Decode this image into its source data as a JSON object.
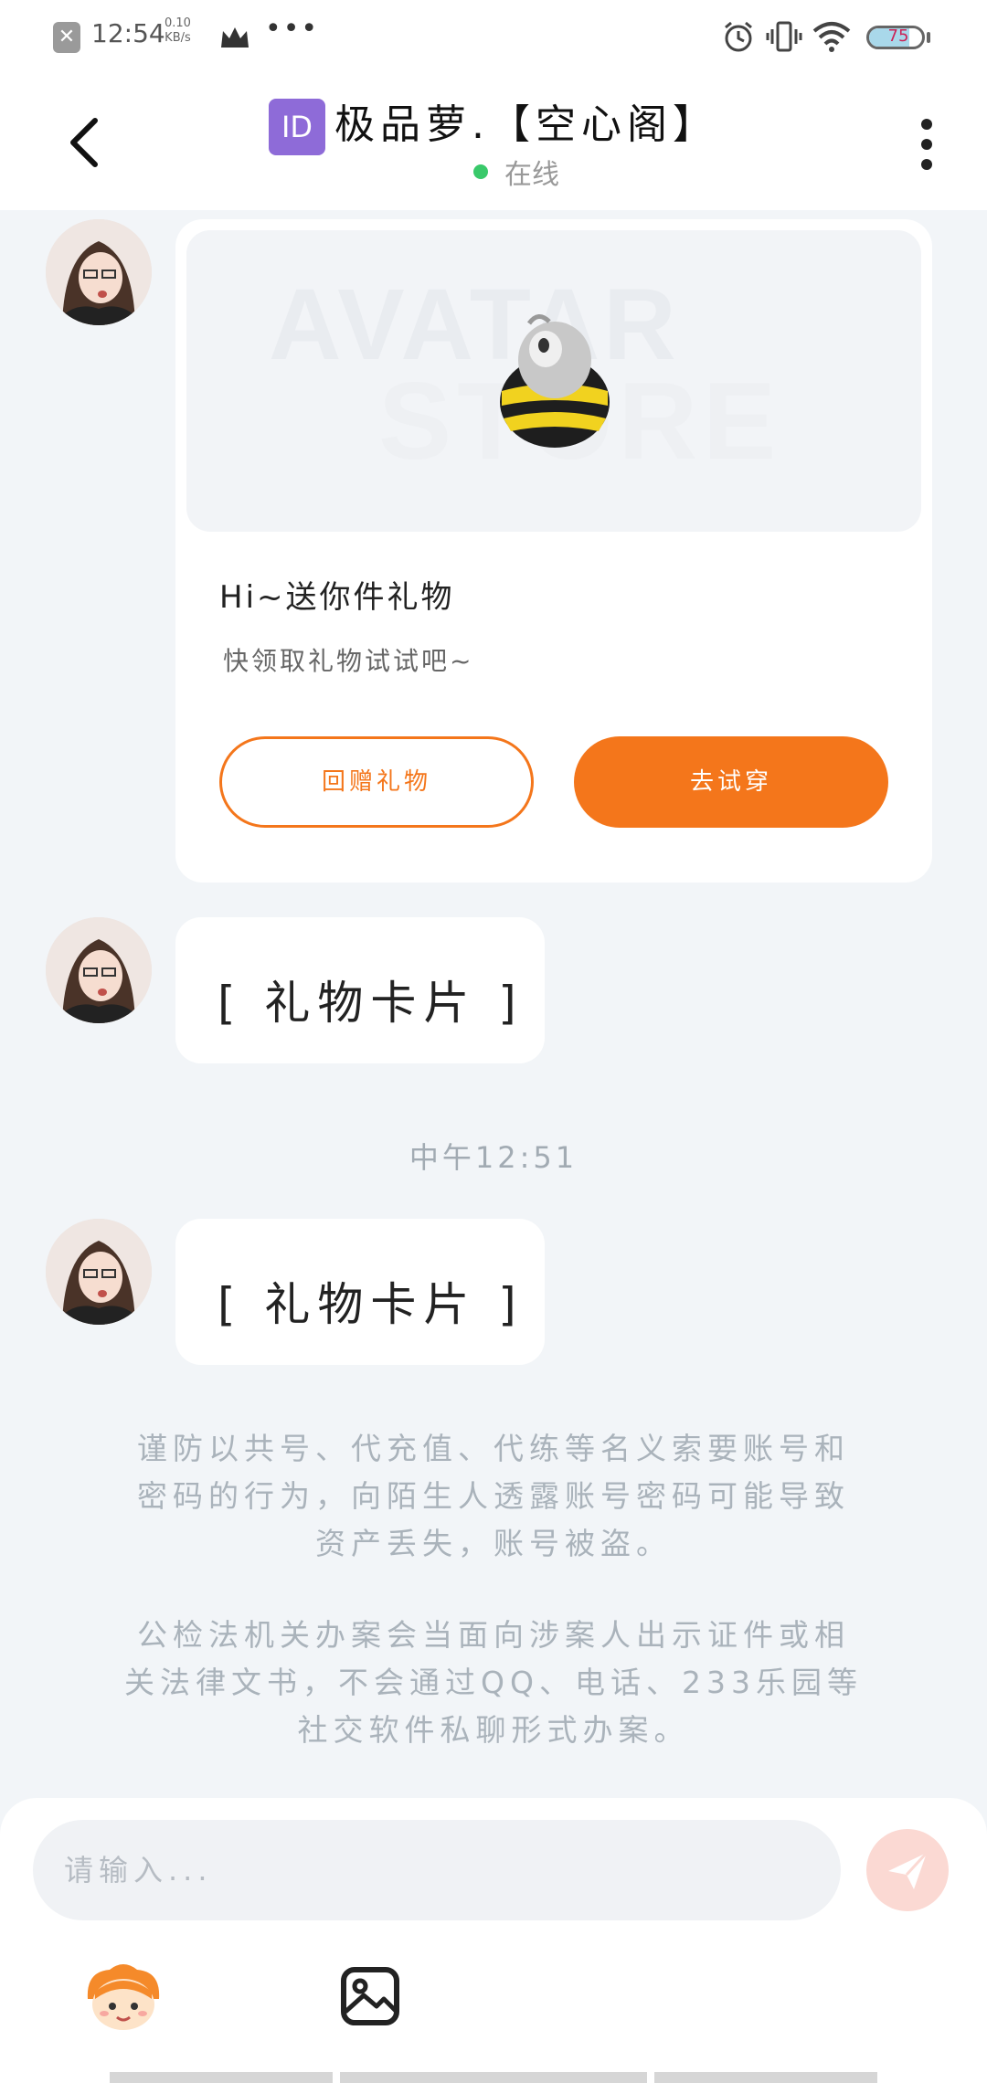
{
  "status_bar": {
    "time": "12:54",
    "speed_value": "0.10",
    "speed_unit": "KB/s",
    "battery": "75",
    "battery_level": 0.75
  },
  "header": {
    "title": "极品萝.【空心阁】",
    "badge": "ID",
    "status": "在线"
  },
  "gift_card": {
    "watermark_line1": "AVATAR",
    "watermark_line2": "STORE",
    "title": "Hi~送你件礼物",
    "subtitle": "快领取礼物试试吧~",
    "return_gift_label": "回赠礼物",
    "try_on_label": "去试穿"
  },
  "messages": [
    {
      "text": "[ 礼物卡片 ]"
    },
    {
      "text": "[ 礼物卡片 ]"
    }
  ],
  "timestamp": "中午12:51",
  "notices": [
    {
      "lines": [
        "谨防以共号、代充值、代练等名义索要账号和",
        "密码的行为，向陌生人透露账号密码可能导致",
        "资产丢失，账号被盗。"
      ]
    },
    {
      "lines": [
        "公检法机关办案会当面向涉案人出示证件或相",
        "关法律文书，不会通过QQ、电话、233乐园等",
        "社交软件私聊形式办案。"
      ]
    }
  ],
  "composer": {
    "placeholder": "请输入..."
  },
  "colors": {
    "accent": "#f4761b",
    "background": "#f2f5f8",
    "online": "#39c96a"
  },
  "icons": [
    "close-notification-icon",
    "crown-icon",
    "more-dots-icon",
    "alarm-icon",
    "vibrate-icon",
    "wifi-icon",
    "battery-icon",
    "back-arrow-icon",
    "more-vertical-icon",
    "send-icon",
    "emoji-avatar-icon",
    "image-icon"
  ]
}
